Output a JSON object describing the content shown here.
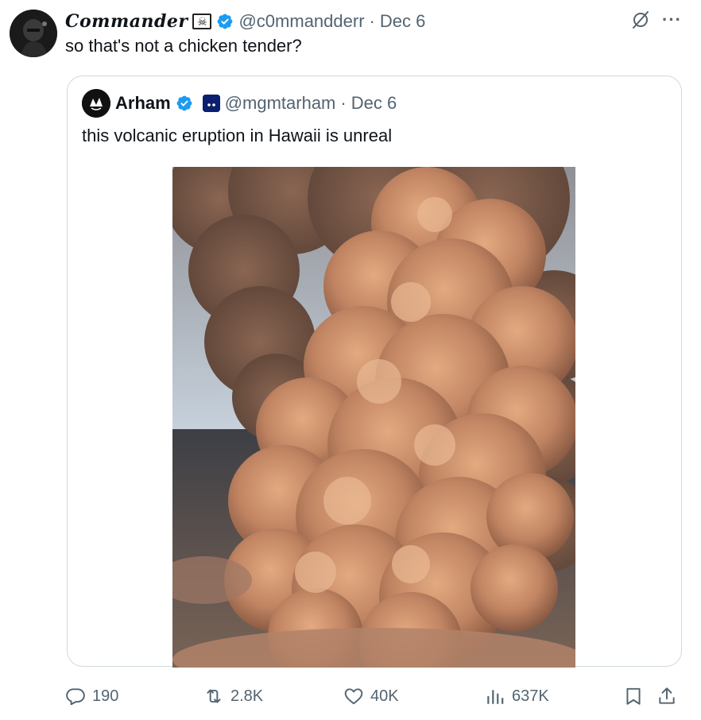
{
  "tweet": {
    "author": {
      "display_name": "Commander",
      "badge_glyph": "☠",
      "handle": "@c0mmandderr",
      "separator": "·",
      "date": "Dec 6"
    },
    "text": "so that's not a chicken tender?",
    "more_label": "···"
  },
  "quote": {
    "author": {
      "display_name": "Arham",
      "handle": "@mgmtarham",
      "separator": "·",
      "date": "Dec 6"
    },
    "text": "this volcanic eruption in Hawaii is unreal",
    "image_icon": "volcano-ash-cloud-photo"
  },
  "actions": {
    "replies": "190",
    "reposts": "2.8K",
    "likes": "40K",
    "views": "637K"
  },
  "colors": {
    "text_primary": "#0f1419",
    "text_secondary": "#536471",
    "border": "#cfd9de",
    "verified_blue": "#1d9bf0"
  },
  "icons": [
    "grok-icon",
    "more-icon",
    "verified-icon",
    "reply-icon",
    "repost-icon",
    "like-icon",
    "views-icon",
    "bookmark-icon",
    "share-icon"
  ]
}
